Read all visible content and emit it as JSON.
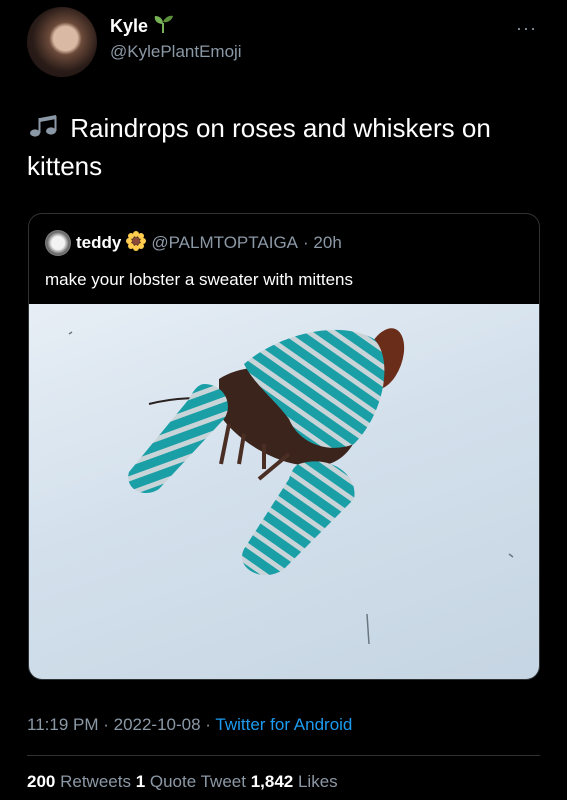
{
  "tweet": {
    "display_name": "Kyle",
    "handle": "@KylePlantEmoji",
    "more_icon": "···",
    "text": "Raindrops on roses and whiskers on kittens",
    "timestamp": "11:19 PM · 2022-10-08 · ",
    "source": "Twitter for Android",
    "stats": {
      "retweets_count": "200",
      "retweets_label": " Retweets ",
      "quotes_count": "1",
      "quotes_label": " Quote Tweet ",
      "likes_count": "1,842",
      "likes_label": " Likes"
    }
  },
  "quote_tweet": {
    "display_name": "teddy",
    "handle": "@PALMTOPTAIGA",
    "time": " · 20h",
    "text": "make your lobster a sweater with mittens"
  },
  "icons": {
    "name_emoji": "seedling-icon",
    "text_emoji": "musical-notes-icon",
    "quote_emoji": "sunflower-icon"
  },
  "colors": {
    "background": "#000000",
    "secondary_text": "#8b98a5",
    "link": "#1d9bf0",
    "yarn_teal": "#1a9fa7"
  }
}
